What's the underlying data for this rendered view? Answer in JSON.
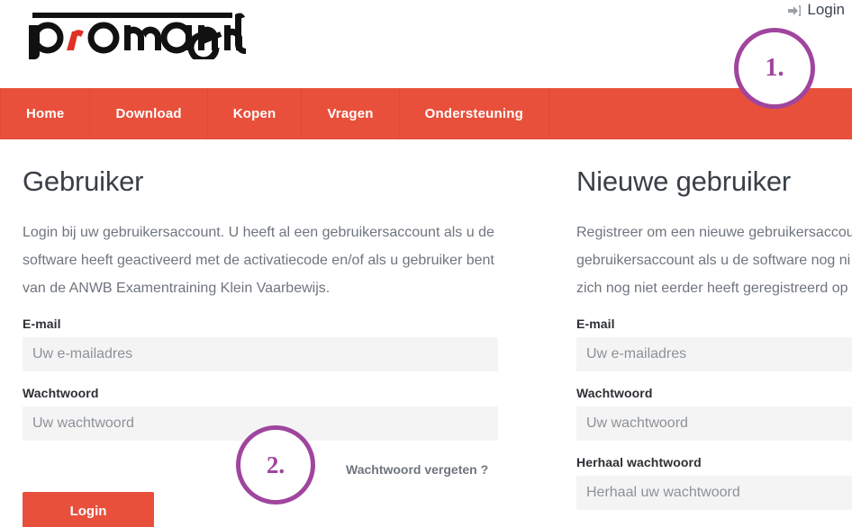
{
  "header": {
    "login_label": "Login",
    "login_icon": "sign-in-arrow-icon",
    "logo_text": "promanent",
    "logo_accent_letter": "r",
    "logo_accent_color": "#e03127"
  },
  "nav": {
    "background_color": "#e8503c",
    "items": [
      {
        "label": "Home"
      },
      {
        "label": "Download"
      },
      {
        "label": "Kopen"
      },
      {
        "label": "Vragen"
      },
      {
        "label": "Ondersteuning"
      }
    ]
  },
  "login_panel": {
    "title": "Gebruiker",
    "intro_lines": [
      "Login bij uw gebruikersaccount. U heeft al een gebruikersaccount als u de",
      "software heeft geactiveerd met de activatiecode en/of als u gebruiker bent",
      "van de ANWB Examentraining Klein Vaarbewijs."
    ],
    "email": {
      "label": "E-mail",
      "placeholder": "Uw e-mailadres",
      "value": ""
    },
    "password": {
      "label": "Wachtwoord",
      "placeholder": "Uw wachtwoord",
      "value": ""
    },
    "forgot_password_label": "Wachtwoord vergeten ?",
    "submit_label": "Login"
  },
  "register_panel": {
    "title": "Nieuwe gebruiker",
    "intro_lines": [
      "Registreer om een nieuwe gebruikersaccou",
      "gebruikersaccount als u de software nog ni",
      "zich nog niet eerder heeft geregistreerd op"
    ],
    "email": {
      "label": "E-mail",
      "placeholder": "Uw e-mailadres",
      "value": ""
    },
    "password": {
      "label": "Wachtwoord",
      "placeholder": "Uw wachtwoord",
      "value": ""
    },
    "repeat_password": {
      "label": "Herhaal wachtwoord",
      "placeholder": "Herhaal uw wachtwoord",
      "value": ""
    }
  },
  "annotations": [
    {
      "label": "1.",
      "color": "#a0459e"
    },
    {
      "label": "2.",
      "color": "#a0459e"
    }
  ]
}
